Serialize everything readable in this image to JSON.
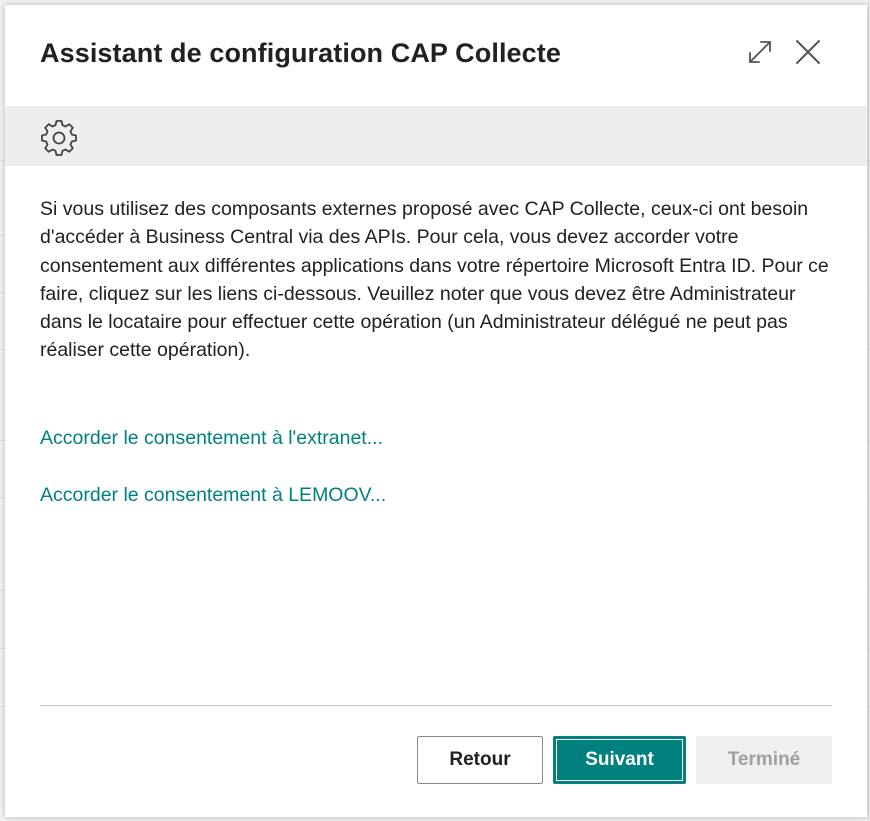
{
  "dialog": {
    "title": "Assistant de configuration CAP Collecte",
    "description": "Si vous utilisez des composants externes proposé avec CAP Collecte, ceux-ci ont besoin d'accéder à Business Central via des APIs. Pour cela, vous devez accorder votre consentement aux différentes applications dans votre répertoire Microsoft Entra ID. Pour ce faire, cliquez sur les liens ci-dessous. Veuillez noter que vous devez être Administrateur dans le locataire pour effectuer cette opération (un Administrateur délégué ne peut pas réaliser cette opération).",
    "links": [
      "Accorder le consentement à l'extranet...",
      "Accorder le consentement à LEMOOV..."
    ],
    "buttons": {
      "back": "Retour",
      "next": "Suivant",
      "done": "Terminé"
    }
  },
  "icons": {
    "expand": "expand-icon",
    "close": "close-icon",
    "banner": "gear-icon"
  },
  "colors": {
    "accent": "#00807e",
    "banner": "#eeeeee",
    "disabled_text": "#a0a0a0"
  }
}
